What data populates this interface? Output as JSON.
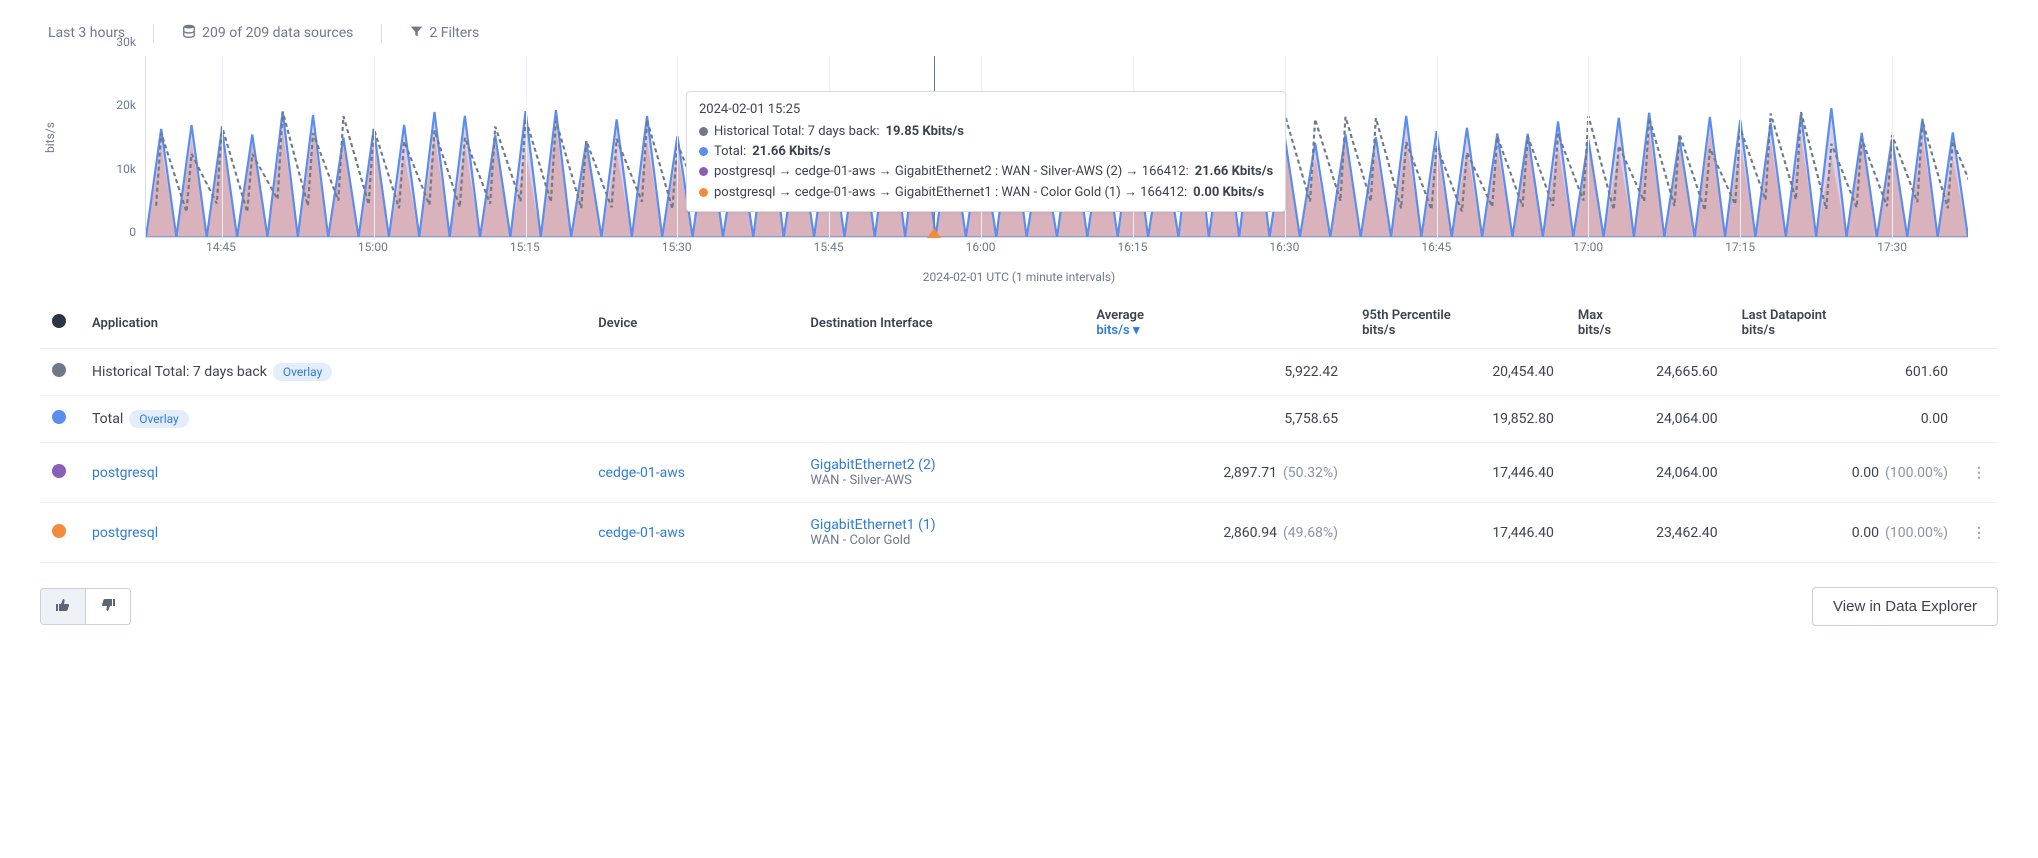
{
  "toolbar": {
    "time_range": "Last 3 hours",
    "data_sources": "209 of 209 data sources",
    "filters": "2 Filters"
  },
  "chart_data": {
    "type": "area",
    "ylabel": "bits/s",
    "xlabel": "2024-02-01 UTC (1 minute intervals)",
    "ylim": [
      0,
      30000
    ],
    "y_ticks": [
      0,
      "10k",
      "20k",
      "30k"
    ],
    "x_ticks": [
      "14:45",
      "15:00",
      "15:15",
      "15:30",
      "15:45",
      "16:00",
      "16:15",
      "16:30",
      "16:45",
      "17:00",
      "17:15",
      "17:30"
    ],
    "cursor_time": "15:25",
    "tooltip": {
      "time": "2024-02-01 15:25",
      "rows": [
        {
          "color": "#6e7a8a",
          "label": "Historical Total: 7 days back:",
          "value": "19.85 Kbits/s"
        },
        {
          "color": "#5b8def",
          "label": "Total:",
          "value": "21.66 Kbits/s"
        },
        {
          "color": "#8b5fb8",
          "label": "postgresql → cedge-01-aws → GigabitEthernet2 : WAN - Silver-AWS (2) → 166412:",
          "value": "21.66 Kbits/s"
        },
        {
          "color": "#f48a3e",
          "label": "postgresql → cedge-01-aws → GigabitEthernet1 : WAN - Color Gold (1) → 166412:",
          "value": "0.00 Kbits/s"
        }
      ]
    }
  },
  "columns": {
    "application": "Application",
    "device": "Device",
    "dest_if": "Destination Interface",
    "avg": "Average",
    "avg_unit": "bits/s",
    "p95": "95th Percentile",
    "p95_unit": "bits/s",
    "max": "Max",
    "max_unit": "bits/s",
    "last": "Last Datapoint",
    "last_unit": "bits/s"
  },
  "overlay_badge": "Overlay",
  "rows": [
    {
      "swatch": "#6e7a8a",
      "application": "Historical Total: 7 days back",
      "overlay": true,
      "device": "",
      "dest_if_main": "",
      "dest_if_sub": "",
      "avg": "5,922.42",
      "avg_pct": "",
      "p95": "20,454.40",
      "max": "24,665.60",
      "last": "601.60",
      "last_pct": "",
      "menu": false
    },
    {
      "swatch": "#5b8def",
      "application": "Total",
      "overlay": true,
      "device": "",
      "dest_if_main": "",
      "dest_if_sub": "",
      "avg": "5,758.65",
      "avg_pct": "",
      "p95": "19,852.80",
      "max": "24,064.00",
      "last": "0.00",
      "last_pct": "",
      "menu": false
    },
    {
      "swatch": "#8b5fb8",
      "application": "postgresql",
      "overlay": false,
      "device": "cedge-01-aws",
      "dest_if_main": "GigabitEthernet2 (2)",
      "dest_if_sub": "WAN - Silver-AWS",
      "avg": "2,897.71",
      "avg_pct": "(50.32%)",
      "p95": "17,446.40",
      "max": "24,064.00",
      "last": "0.00",
      "last_pct": "(100.00%)",
      "menu": true
    },
    {
      "swatch": "#f48a3e",
      "application": "postgresql",
      "overlay": false,
      "device": "cedge-01-aws",
      "dest_if_main": "GigabitEthernet1 (1)",
      "dest_if_sub": "WAN - Color Gold",
      "avg": "2,860.94",
      "avg_pct": "(49.68%)",
      "p95": "17,446.40",
      "max": "23,462.40",
      "last": "0.00",
      "last_pct": "(100.00%)",
      "menu": true
    }
  ],
  "footer": {
    "view_btn": "View in Data Explorer"
  }
}
